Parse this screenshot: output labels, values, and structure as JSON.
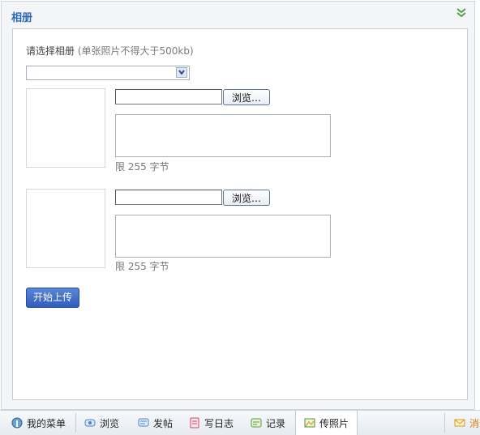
{
  "panel": {
    "title": "相册",
    "collapse_icon": "double-chevron-down-icon"
  },
  "form": {
    "prompt": "请选择相册",
    "hint": "(单张照片不得大于500kb)",
    "album_select_value": "",
    "browse_label": "浏览…",
    "limit_text": "限 255 字节",
    "upload_label": "开始上传"
  },
  "taskbar": {
    "items": [
      {
        "label": "我的菜单",
        "icon": "menu-icon"
      },
      {
        "label": "浏览",
        "icon": "eye-icon"
      },
      {
        "label": "发帖",
        "icon": "post-icon"
      },
      {
        "label": "写日志",
        "icon": "journal-icon"
      },
      {
        "label": "记录",
        "icon": "record-icon"
      },
      {
        "label": "传照片",
        "icon": "photo-upload-icon"
      },
      {
        "label": "消",
        "icon": "mail-icon"
      }
    ]
  },
  "colors": {
    "accent": "#2a69b3",
    "button": "#3a68c6"
  }
}
